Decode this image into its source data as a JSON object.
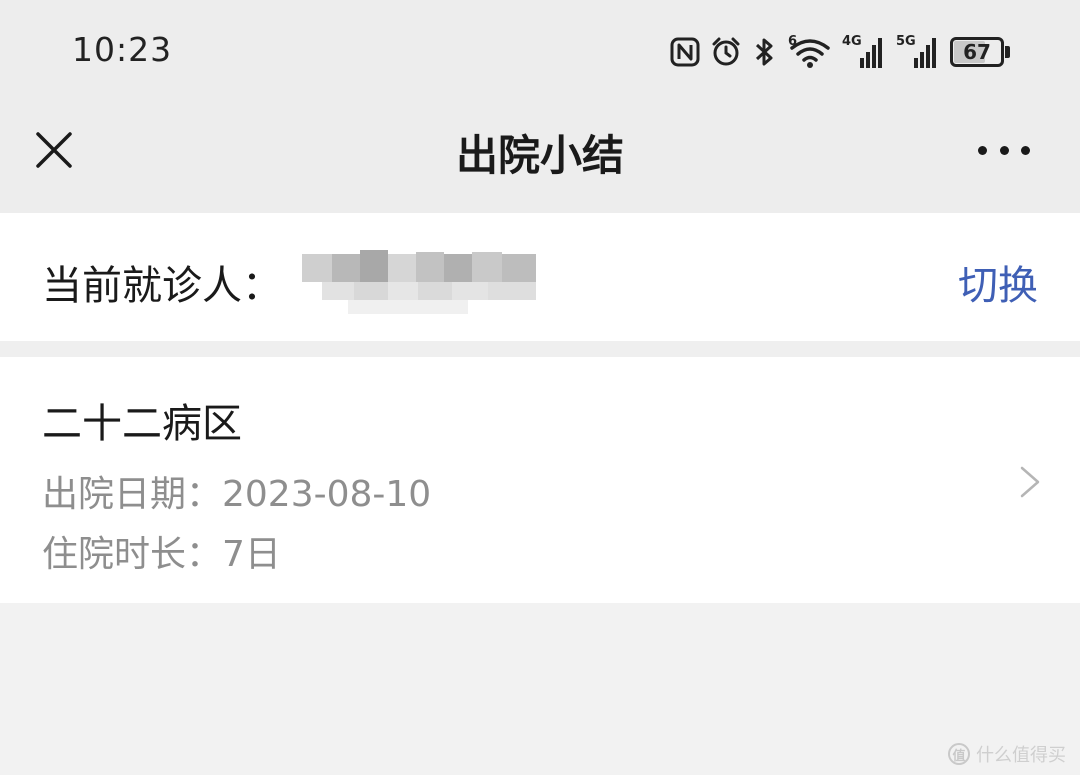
{
  "status_bar": {
    "time": "10:23",
    "icons": [
      "nfc-icon",
      "alarm-icon",
      "bluetooth-icon",
      "wifi-6-icon",
      "signal-4g-icon",
      "signal-5g-icon",
      "battery-icon"
    ],
    "wifi_tag": "6",
    "net1_tag": "4G",
    "net2_tag": "5G",
    "battery_level": "67"
  },
  "nav": {
    "title": "出院小结",
    "close_icon": "close-icon",
    "more_icon": "more-icon"
  },
  "patient": {
    "label": "当前就诊人：",
    "name_redacted": true,
    "switch_label": "切换"
  },
  "record": {
    "ward": "二十二病区",
    "discharge_date_line": "出院日期：2023-08-10",
    "stay_length_line": "住院时长：7日",
    "chevron_icon": "chevron-right-icon"
  },
  "watermark": {
    "logo_char": "值",
    "text": "什么值得买"
  },
  "colors": {
    "header_bg": "#ededed",
    "page_bg": "#f2f2f2",
    "link": "#3f5fb5",
    "muted": "#8e8e8e"
  }
}
